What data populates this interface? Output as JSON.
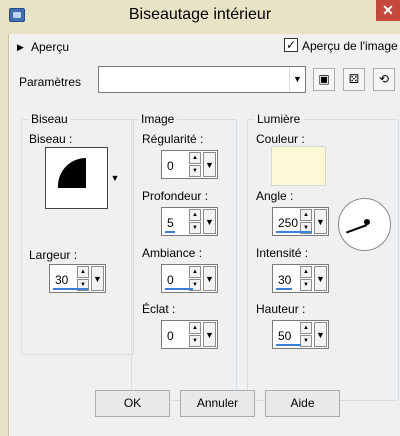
{
  "window": {
    "title": "Biseautage intérieur",
    "close_glyph": "✕"
  },
  "preview": {
    "label": "Aperçu",
    "checkbox_label": "Aperçu de l'image",
    "checked": true
  },
  "settings": {
    "label": "Paramètres",
    "preset_value": ""
  },
  "toolbar_icons": [
    "save-icon",
    "randomize-icon",
    "reset-icon"
  ],
  "groups": {
    "biseau": {
      "title": "Biseau",
      "shape_label": "Biseau :",
      "width_label": "Largeur :",
      "width_value": "30"
    },
    "image": {
      "title": "Image",
      "regularity_label": "Régularité :",
      "regularity_value": "0",
      "depth_label": "Profondeur :",
      "depth_value": "5",
      "ambiance_label": "Ambiance :",
      "ambiance_value": "0",
      "shine_label": "Éclat :",
      "shine_value": "0"
    },
    "light": {
      "title": "Lumière",
      "color_label": "Couleur :",
      "color": "#fdf9d7",
      "angle_label": "Angle :",
      "angle_value": "250",
      "intensity_label": "Intensité :",
      "intensity_value": "30",
      "height_label": "Hauteur :",
      "height_value": "50"
    }
  },
  "buttons": {
    "ok": "OK",
    "cancel": "Annuler",
    "help": "Aide"
  },
  "colors": {
    "accent": "#3d7fd6",
    "close": "#c7493c",
    "frame": "#e9e3c5"
  }
}
